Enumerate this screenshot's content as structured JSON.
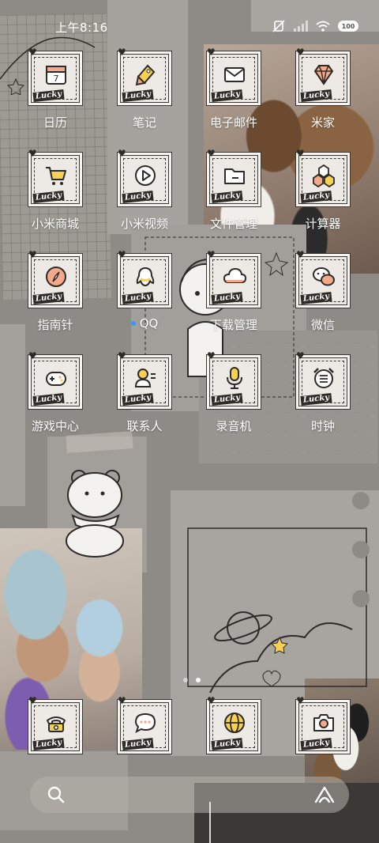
{
  "status": {
    "time": "上午8:16",
    "battery": "100",
    "icons": [
      "mute-icon",
      "signal-icon",
      "wifi-icon",
      "battery-icon"
    ]
  },
  "apps": [
    {
      "label": "日历",
      "icon": "calendar-icon",
      "glyph_text": "7"
    },
    {
      "label": "笔记",
      "icon": "notes-tag-icon"
    },
    {
      "label": "电子邮件",
      "icon": "mail-icon"
    },
    {
      "label": "米家",
      "icon": "diamond-icon"
    },
    {
      "label": "小米商城",
      "icon": "shopping-cart-icon"
    },
    {
      "label": "小米视频",
      "icon": "play-icon"
    },
    {
      "label": "文件管理",
      "icon": "folder-icon"
    },
    {
      "label": "计算器",
      "icon": "calculator-icon"
    },
    {
      "label": "指南针",
      "icon": "compass-icon"
    },
    {
      "label": "QQ",
      "icon": "qq-icon"
    },
    {
      "label": "下载管理",
      "icon": "cloud-download-icon"
    },
    {
      "label": "微信",
      "icon": "wechat-icon"
    },
    {
      "label": "游戏中心",
      "icon": "gamepad-icon"
    },
    {
      "label": "联系人",
      "icon": "contacts-icon"
    },
    {
      "label": "录音机",
      "icon": "microphone-icon"
    },
    {
      "label": "时钟",
      "icon": "alarm-clock-icon"
    }
  ],
  "dock": [
    {
      "icon": "phone-icon"
    },
    {
      "icon": "message-icon"
    },
    {
      "icon": "browser-globe-icon"
    },
    {
      "icon": "camera-icon"
    }
  ],
  "tile_badge": "Lucky",
  "accent_colors": {
    "tile_fill": "#edeae6",
    "icon_yellow": "#f7d154",
    "icon_peach": "#f4a98b",
    "new_dot": "#2f9bff"
  },
  "page_indicator": {
    "count": 2,
    "active": 2
  }
}
